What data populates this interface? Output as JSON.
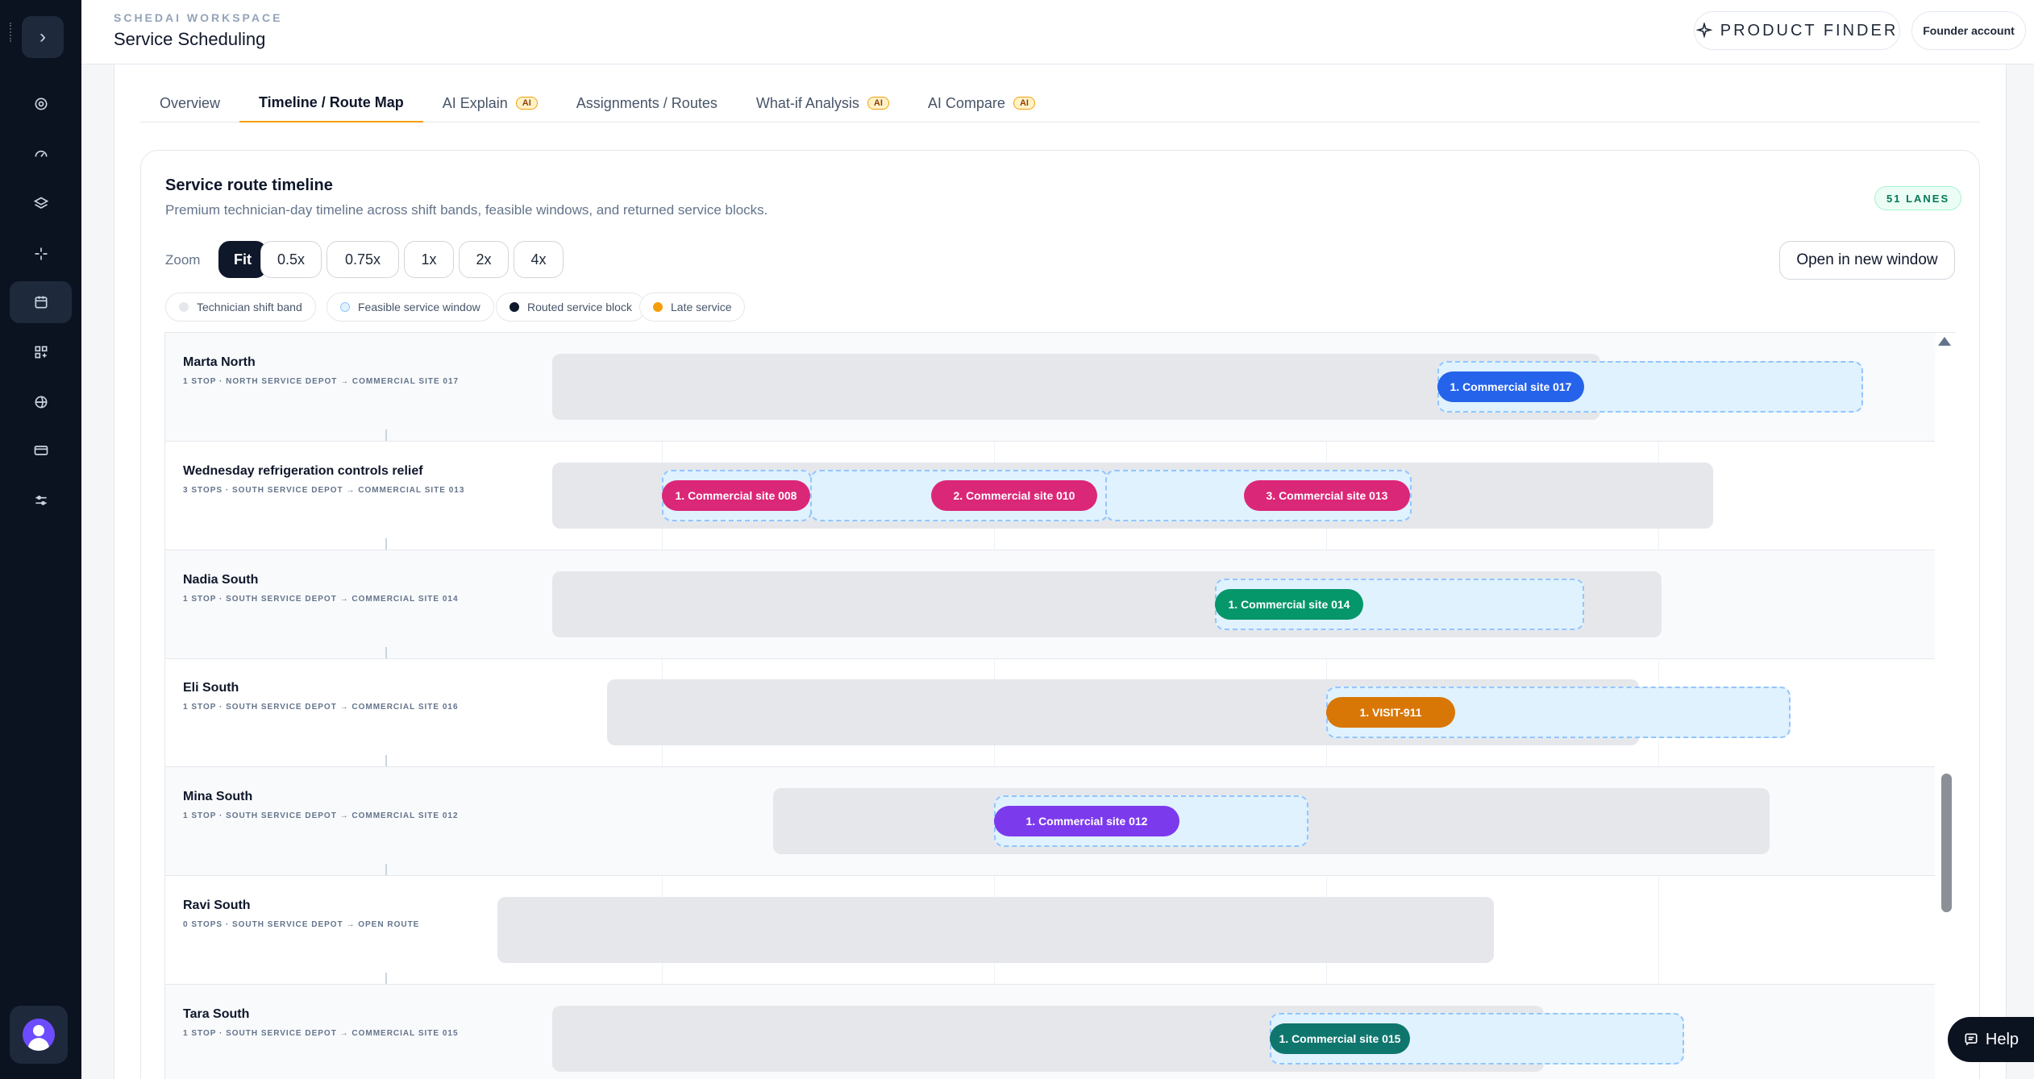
{
  "sidebar": {
    "toggle_icon": "chevron-right-icon",
    "items": [
      {
        "name": "settings-icon"
      },
      {
        "name": "gauge-icon"
      },
      {
        "name": "layers-icon"
      },
      {
        "name": "sparkles-icon"
      },
      {
        "name": "calendar-icon",
        "active": true
      },
      {
        "name": "grid-plus-icon"
      },
      {
        "name": "globe-icon"
      },
      {
        "name": "credit-card-icon"
      },
      {
        "name": "sliders-icon"
      }
    ]
  },
  "header": {
    "workspace": "SCHEDAI WORKSPACE",
    "title": "Service Scheduling",
    "product_finder": "PRODUCT FINDER",
    "account": "Founder account"
  },
  "tabs": [
    {
      "label": "Overview",
      "ai": false,
      "active": false
    },
    {
      "label": "Timeline / Route Map",
      "ai": false,
      "active": true
    },
    {
      "label": "AI Explain",
      "ai": true,
      "active": false
    },
    {
      "label": "Assignments / Routes",
      "ai": false,
      "active": false
    },
    {
      "label": "What-if Analysis",
      "ai": true,
      "active": false
    },
    {
      "label": "AI Compare",
      "ai": true,
      "active": false
    }
  ],
  "ai_badge": "AI",
  "panel": {
    "title": "Service route timeline",
    "subtitle": "Premium technician-day timeline across shift bands, feasible windows, and returned service blocks.",
    "lanes_badge": "51 LANES",
    "zoom_label": "Zoom",
    "zoom_options": [
      "Fit",
      "0.5x",
      "0.75x",
      "1x",
      "2x",
      "4x"
    ],
    "zoom_selected": "Fit",
    "open_window": "Open in new window"
  },
  "legend": [
    {
      "label": "Technician shift band",
      "color": "#e5e7eb"
    },
    {
      "label": "Feasible service window",
      "color": "#e0f2fe"
    },
    {
      "label": "Routed service block",
      "color": "#0f172a"
    },
    {
      "label": "Late service",
      "color": "#f59e0b"
    }
  ],
  "lanes": [
    {
      "name": "Marta North",
      "route": "1 STOP · NORTH SERVICE DEPOT → COMMERCIAL SITE 017",
      "blocks": [
        {
          "label": "1. Commercial site 017",
          "color": "#2563eb"
        }
      ]
    },
    {
      "name": "Wednesday refrigeration controls relief",
      "route": "3 STOPS · SOUTH SERVICE DEPOT → COMMERCIAL SITE 013",
      "blocks": [
        {
          "label": "1. Commercial site 008",
          "color": "#db2777"
        },
        {
          "label": "2. Commercial site 010",
          "color": "#db2777"
        },
        {
          "label": "3. Commercial site 013",
          "color": "#db2777"
        }
      ]
    },
    {
      "name": "Nadia South",
      "route": "1 STOP · SOUTH SERVICE DEPOT → COMMERCIAL SITE 014",
      "blocks": [
        {
          "label": "1. Commercial site 014",
          "color": "#059669"
        }
      ]
    },
    {
      "name": "Eli South",
      "route": "1 STOP · SOUTH SERVICE DEPOT → COMMERCIAL SITE 016",
      "blocks": [
        {
          "label": "1. VISIT-911",
          "color": "#d97706"
        }
      ]
    },
    {
      "name": "Mina South",
      "route": "1 STOP · SOUTH SERVICE DEPOT → COMMERCIAL SITE 012",
      "blocks": [
        {
          "label": "1. Commercial site 012",
          "color": "#7c3aed"
        }
      ]
    },
    {
      "name": "Ravi South",
      "route": "0 STOPS · SOUTH SERVICE DEPOT → OPEN ROUTE",
      "blocks": []
    },
    {
      "name": "Tara South",
      "route": "1 STOP · SOUTH SERVICE DEPOT → COMMERCIAL SITE 015",
      "blocks": [
        {
          "label": "1. Commercial site 015",
          "color": "#0f766e"
        }
      ]
    }
  ],
  "help": "Help"
}
